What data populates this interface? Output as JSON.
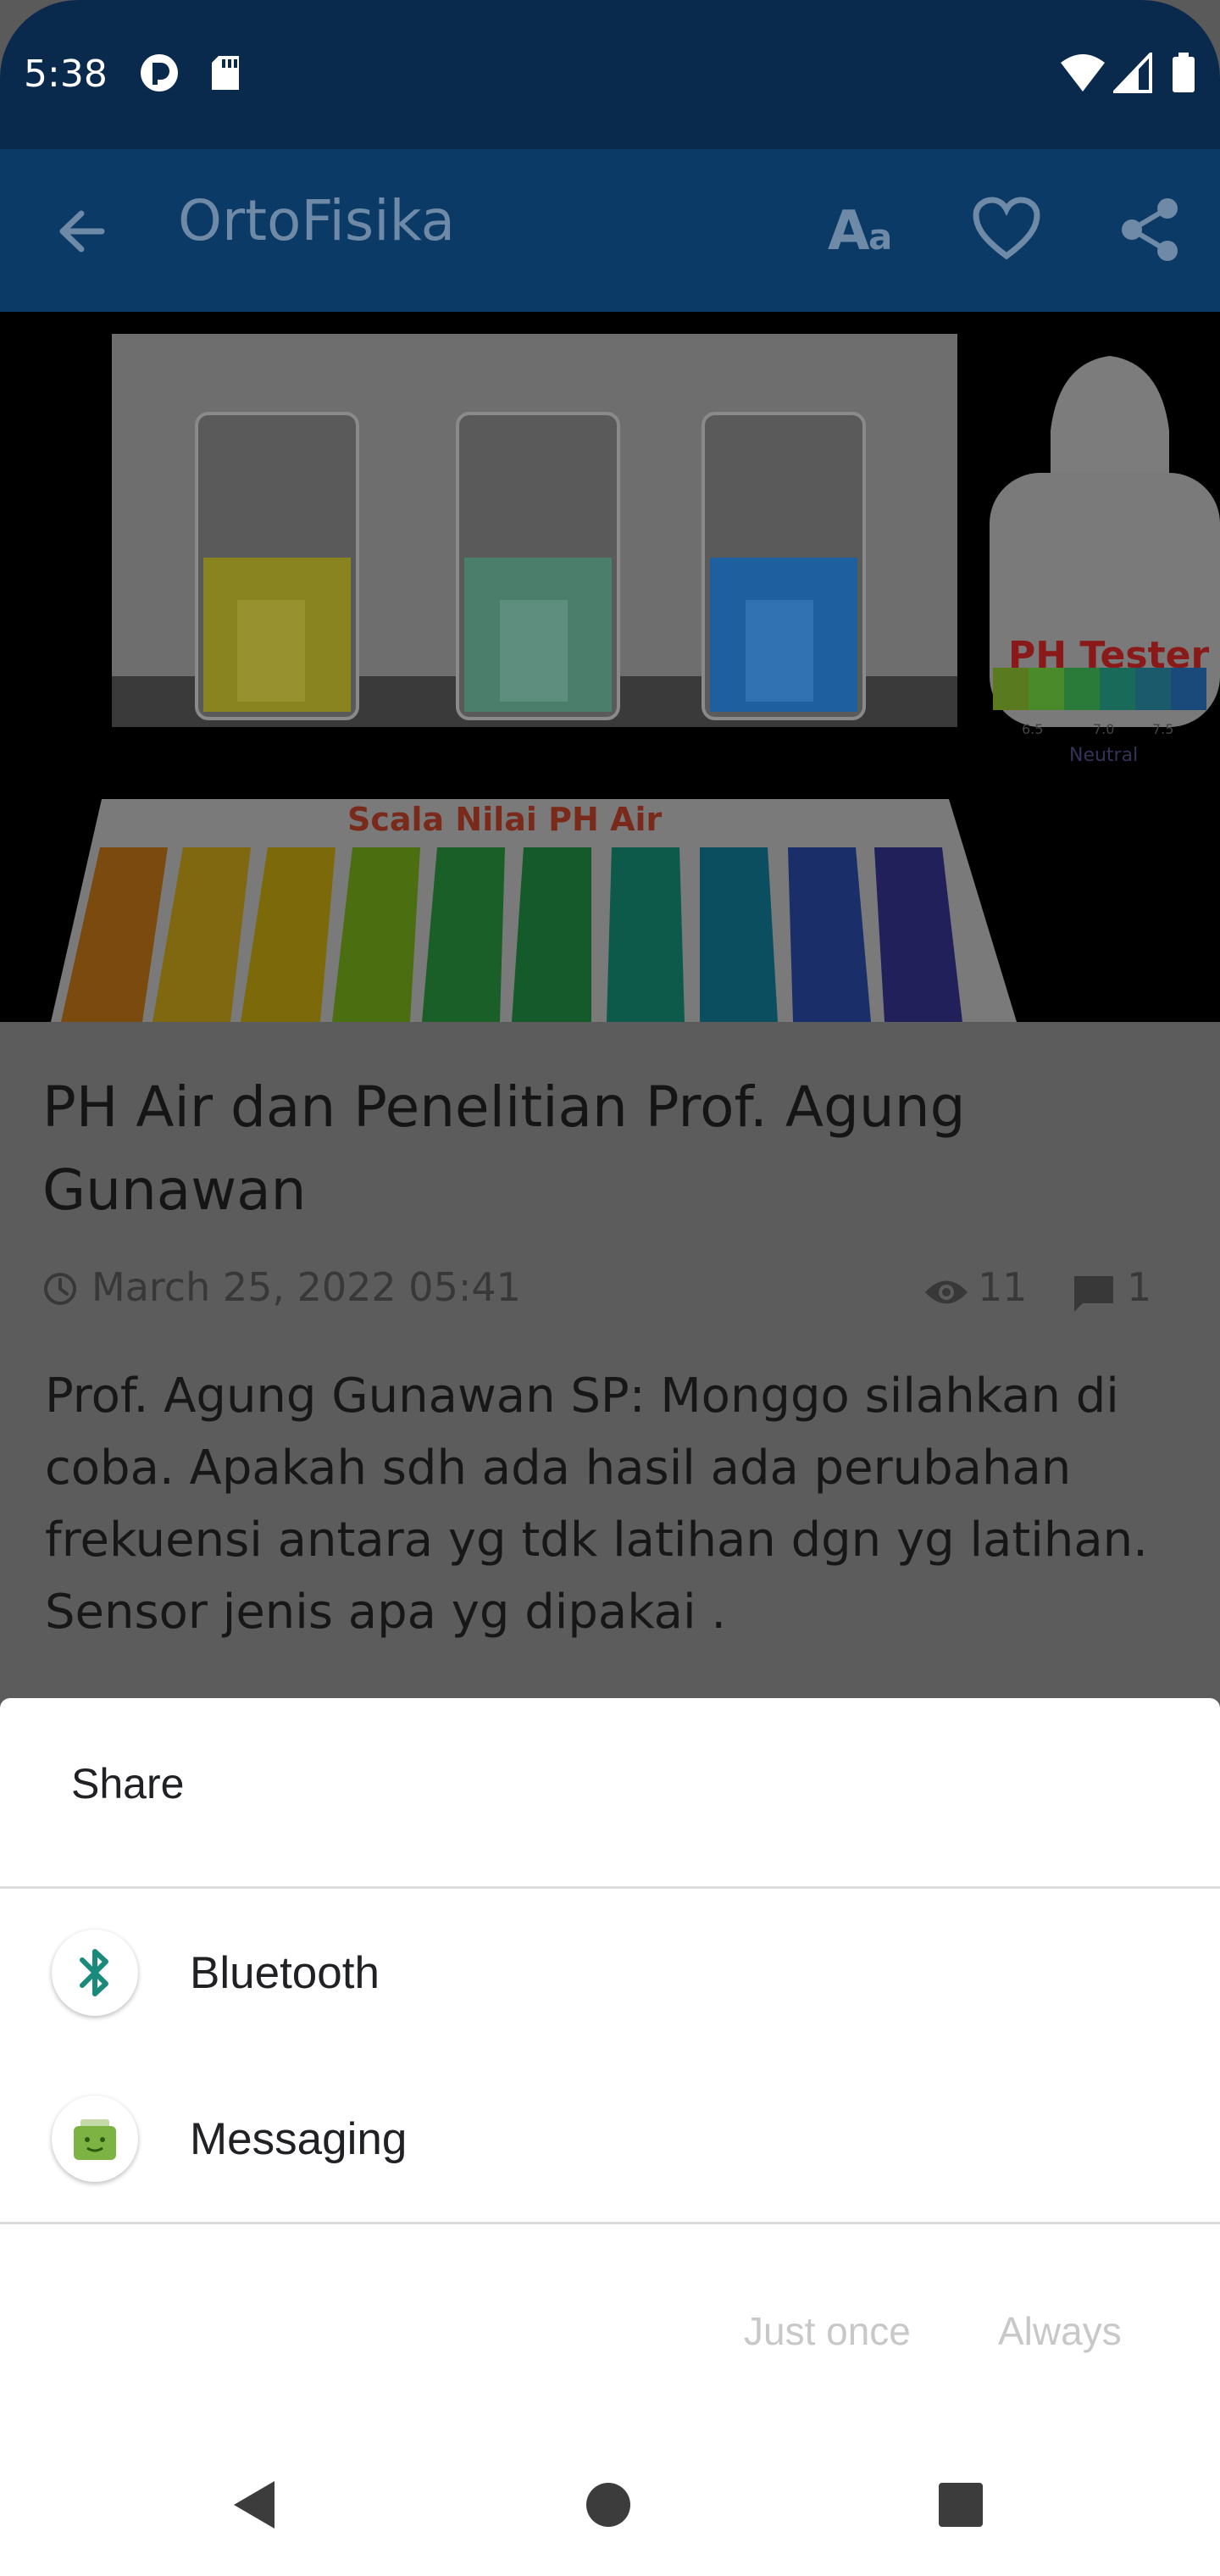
{
  "status_bar": {
    "time": "5:38"
  },
  "toolbar": {
    "title": "OrtoFisika",
    "icons": [
      "back-arrow-icon",
      "font-size-icon",
      "heart-icon",
      "share-icon"
    ]
  },
  "hero": {
    "caption": "Scala Nilai PH Air",
    "bottle_label": "PH Tester",
    "bottle_sublabel": "Neutral",
    "bottle_ticks": [
      "6.5",
      "7.0",
      "7.5"
    ]
  },
  "article": {
    "title": "PH Air dan Penelitian Prof. Agung Gunawan",
    "date": "March 25, 2022 05:41",
    "views": "11",
    "comments": "1",
    "body": "Prof. Agung Gunawan SP: Monggo silahkan di coba. Apakah sdh ada hasil ada perubahan frekuensi antara yg tdk latihan dgn yg latihan. Sensor jenis apa yg dipakai ."
  },
  "share_sheet": {
    "title": "Share",
    "apps": [
      {
        "label": "Bluetooth",
        "icon": "bluetooth-icon"
      },
      {
        "label": "Messaging",
        "icon": "messaging-icon"
      }
    ],
    "just_once": "Just once",
    "always": "Always"
  },
  "colors": {
    "status_bar": "#0a2a4d",
    "toolbar": "#0c3a66",
    "scrim": "#5c5c5c",
    "sheet": "#ffffff",
    "bluetooth": "#1a8a7a",
    "messaging": "#7cb342"
  }
}
